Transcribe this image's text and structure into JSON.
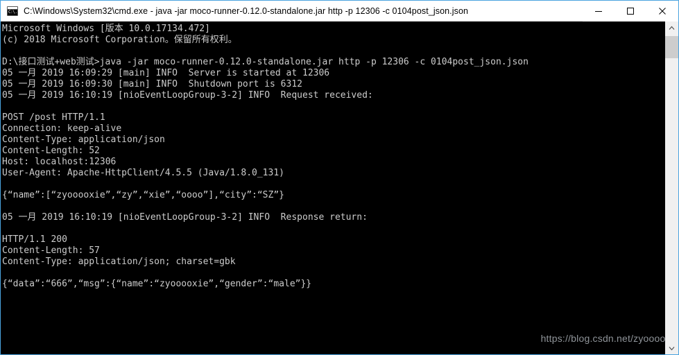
{
  "window": {
    "title": "C:\\Windows\\System32\\cmd.exe - java   -jar moco-runner-0.12.0-standalone.jar http -p 12306 -c 0104post_json.json",
    "icon_name": "cmd-icon",
    "icon_glyph": "C:\\.",
    "accent_border": "#4aa3df",
    "titlebar_bg": "#ffffff",
    "console_bg": "#000000",
    "console_fg": "#cccccc"
  },
  "caption": {
    "minimize_label": "Minimize",
    "maximize_label": "Maximize",
    "close_label": "Close"
  },
  "console": {
    "lines": [
      "Microsoft Windows [版本 10.0.17134.472]",
      "(c) 2018 Microsoft Corporation。保留所有权利。",
      "",
      "D:\\接口测试+web测试>java -jar moco-runner-0.12.0-standalone.jar http -p 12306 -c 0104post_json.json",
      "05 一月 2019 16:09:29 [main] INFO  Server is started at 12306",
      "05 一月 2019 16:09:30 [main] INFO  Shutdown port is 6312",
      "05 一月 2019 16:10:19 [nioEventLoopGroup-3-2] INFO  Request received:",
      "",
      "POST /post HTTP/1.1",
      "Connection: keep-alive",
      "Content-Type: application/json",
      "Content-Length: 52",
      "Host: localhost:12306",
      "User-Agent: Apache-HttpClient/4.5.5 (Java/1.8.0_131)",
      "",
      "{“name”:[“zyooooxie”,“zy”,“xie”,“oooo”],“city”:“SZ”}",
      "",
      "05 一月 2019 16:10:19 [nioEventLoopGroup-3-2] INFO  Response return:",
      "",
      "HTTP/1.1 200",
      "Content-Length: 57",
      "Content-Type: application/json; charset=gbk",
      "",
      "{“data”:“666”,“msg”:{“name”:“zyooooxie”,“gender”:“male”}}"
    ]
  },
  "watermark": {
    "text": "https://blog.csdn.net/zyooooxie"
  },
  "scrollbar": {
    "up_label": "Scroll up",
    "down_label": "Scroll down",
    "thumb_label": "Scroll thumb"
  }
}
